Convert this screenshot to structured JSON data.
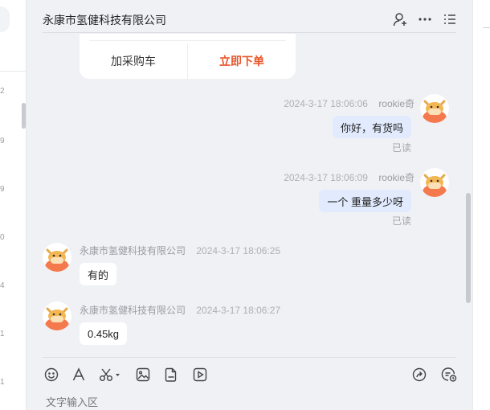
{
  "sidebar": {
    "visible_numbers": [
      "2",
      "9",
      "9",
      "0",
      "4",
      "1",
      "1"
    ]
  },
  "header": {
    "title": "永康市氢健科技有限公司",
    "icons": [
      "add-contact-icon",
      "more-icon",
      "menu-icon"
    ]
  },
  "product_card": {
    "add_to_cart": "加采购车",
    "buy_now": "立即下单"
  },
  "messages": [
    {
      "side": "right",
      "sender": "rookie奇",
      "time": "2024-3-17 18:06:06",
      "text": "你好，有货吗",
      "status": "已读"
    },
    {
      "side": "right",
      "sender": "rookie奇",
      "time": "2024-3-17 18:06:09",
      "text": "一个 重量多少呀",
      "status": "已读"
    },
    {
      "side": "left",
      "sender": "永康市氢健科技有限公司",
      "time": "2024-3-17 18:06:25",
      "text": "有的"
    },
    {
      "side": "left",
      "sender": "永康市氢健科技有限公司",
      "time": "2024-3-17 18:06:27",
      "text": "0.45kg"
    }
  ],
  "toolbar": {
    "left_tools": [
      "emoji-icon",
      "font-icon",
      "scissors-icon",
      "image-icon",
      "file-icon",
      "video-icon"
    ],
    "right_tools": [
      "share-icon",
      "chat-history-icon"
    ]
  },
  "composer": {
    "placeholder": "文字输入区"
  },
  "colors": {
    "accent_buy": "#e8562a",
    "mine_bubble": "#e1ebfd",
    "background": "#f0f1f5"
  }
}
